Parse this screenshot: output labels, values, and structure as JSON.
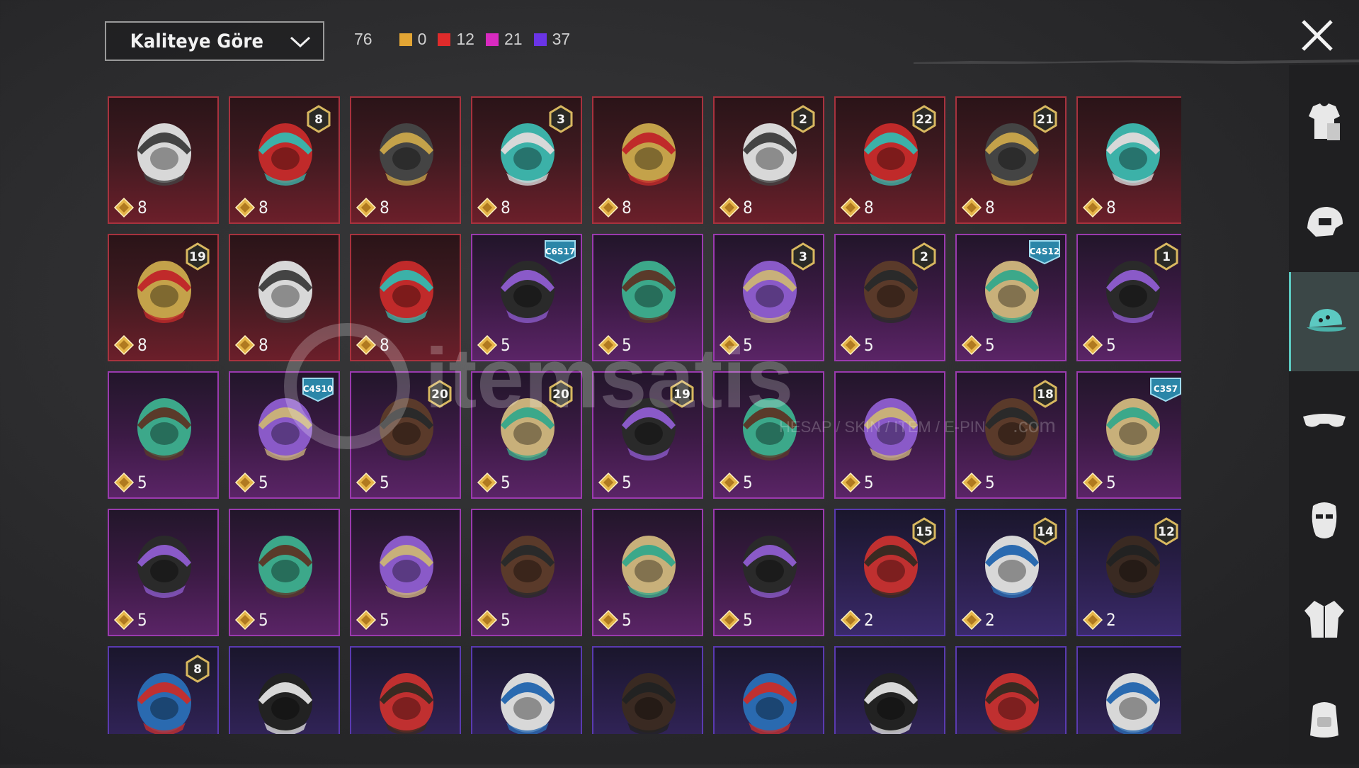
{
  "sort_dropdown": {
    "label": "Kaliteye Göre"
  },
  "counts": {
    "total": "76",
    "chips": [
      {
        "color": "#e2a534",
        "value": "0"
      },
      {
        "color": "#e02b2b",
        "value": "12"
      },
      {
        "color": "#d82ac0",
        "value": "21"
      },
      {
        "color": "#6a34e6",
        "value": "37"
      }
    ]
  },
  "watermark": {
    "brand": "itemsatis",
    "tagline": "HESAP / SKIN / ITEM / E-PIN",
    "domain": ".com"
  },
  "items": [
    {
      "rarity": "red",
      "price": "8",
      "badge": "",
      "art": "cowboy-hat-icon"
    },
    {
      "rarity": "red",
      "price": "8",
      "badge": "8",
      "art": "winged-hair-icon"
    },
    {
      "rarity": "red",
      "price": "8",
      "badge": "",
      "art": "red-helmet-icon"
    },
    {
      "rarity": "red",
      "price": "8",
      "badge": "3",
      "art": "joker-mask-icon"
    },
    {
      "rarity": "red",
      "price": "8",
      "badge": "",
      "art": "fin-helmet-icon"
    },
    {
      "rarity": "red",
      "price": "8",
      "badge": "2",
      "art": "bucket-hat-icon"
    },
    {
      "rarity": "red",
      "price": "8",
      "badge": "22",
      "art": "golden-mask-icon"
    },
    {
      "rarity": "red",
      "price": "8",
      "badge": "21",
      "art": "demon-mask-icon"
    },
    {
      "rarity": "red",
      "price": "8",
      "badge": "",
      "art": "horned-mask-icon"
    },
    {
      "rarity": "red",
      "price": "8",
      "badge": "19",
      "art": "robot-helmet-icon"
    },
    {
      "rarity": "red",
      "price": "8",
      "badge": "",
      "art": "red-armor-helmet-icon"
    },
    {
      "rarity": "red",
      "price": "8",
      "badge": "",
      "art": "knight-helmet-icon"
    },
    {
      "rarity": "mag",
      "price": "5",
      "badge": "C6S17",
      "art": "visor-hair-icon"
    },
    {
      "rarity": "mag",
      "price": "5",
      "badge": "",
      "art": "braided-hair-icon"
    },
    {
      "rarity": "mag",
      "price": "5",
      "badge": "3",
      "art": "jester-hat-icon"
    },
    {
      "rarity": "mag",
      "price": "5",
      "badge": "2",
      "art": "nurse-cap-icon"
    },
    {
      "rarity": "mag",
      "price": "5",
      "badge": "C4S12",
      "art": "headband-hair-icon"
    },
    {
      "rarity": "mag",
      "price": "5",
      "badge": "1",
      "art": "twin-tails-icon"
    },
    {
      "rarity": "mag",
      "price": "5",
      "badge": "",
      "art": "long-hair-icon"
    },
    {
      "rarity": "mag",
      "price": "5",
      "badge": "C4S10",
      "art": "green-helmet-icon"
    },
    {
      "rarity": "mag",
      "price": "5",
      "badge": "20",
      "art": "bunny-blonde-icon"
    },
    {
      "rarity": "mag",
      "price": "5",
      "badge": "20",
      "art": "gold-skull-icon"
    },
    {
      "rarity": "mag",
      "price": "5",
      "badge": "19",
      "art": "bow-hair-icon"
    },
    {
      "rarity": "mag",
      "price": "5",
      "badge": "",
      "art": "red-pigtails-icon"
    },
    {
      "rarity": "mag",
      "price": "5",
      "badge": "",
      "art": "blue-beast-icon"
    },
    {
      "rarity": "mag",
      "price": "5",
      "badge": "18",
      "art": "dark-hair-icon"
    },
    {
      "rarity": "mag",
      "price": "5",
      "badge": "C3S7",
      "art": "maid-headband-icon"
    },
    {
      "rarity": "mag",
      "price": "5",
      "badge": "",
      "art": "straw-hat-icon"
    },
    {
      "rarity": "mag",
      "price": "5",
      "badge": "",
      "art": "hooded-helmet-icon"
    },
    {
      "rarity": "mag",
      "price": "5",
      "badge": "",
      "art": "gas-mask-helmet-icon"
    },
    {
      "rarity": "mag",
      "price": "5",
      "badge": "",
      "art": "kendo-helmet-icon"
    },
    {
      "rarity": "mag",
      "price": "5",
      "badge": "",
      "art": "camel-hat-icon"
    },
    {
      "rarity": "mag",
      "price": "5",
      "badge": "",
      "art": "spiked-mask-icon"
    },
    {
      "rarity": "pur",
      "price": "2",
      "badge": "15",
      "art": "pumpkin-beanie-icon"
    },
    {
      "rarity": "pur",
      "price": "2",
      "badge": "14",
      "art": "cat-cap-hair-icon"
    },
    {
      "rarity": "pur",
      "price": "2",
      "badge": "12",
      "art": "bunny-helmet-icon"
    },
    {
      "rarity": "pur",
      "price": "",
      "badge": "8",
      "art": "green-skull-hair-icon"
    },
    {
      "rarity": "pur",
      "price": "",
      "badge": "",
      "art": "blue-cap-icon"
    },
    {
      "rarity": "pur",
      "price": "",
      "badge": "",
      "art": "goggle-helmet-icon"
    },
    {
      "rarity": "pur",
      "price": "",
      "badge": "",
      "art": "tactical-helmet-icon"
    },
    {
      "rarity": "pur",
      "price": "",
      "badge": "",
      "art": "red-white-cap-icon"
    },
    {
      "rarity": "pur",
      "price": "",
      "badge": "",
      "art": "beanie-icon"
    },
    {
      "rarity": "pur",
      "price": "",
      "badge": "",
      "art": "football-helmet-icon"
    },
    {
      "rarity": "pur",
      "price": "",
      "badge": "",
      "art": "cricket-helmet-icon"
    },
    {
      "rarity": "pur",
      "price": "",
      "badge": "",
      "art": "cyber-helmet-hair-icon"
    }
  ],
  "sidebar": {
    "tabs": [
      {
        "icon": "outfit-icon",
        "active": false
      },
      {
        "icon": "helmet-icon",
        "active": false
      },
      {
        "icon": "cap-icon",
        "active": true
      },
      {
        "icon": "glasses-icon",
        "active": false
      },
      {
        "icon": "mask-icon",
        "active": false
      },
      {
        "icon": "jacket-icon",
        "active": false
      },
      {
        "icon": "backpack-icon",
        "active": false
      }
    ]
  },
  "colors": {
    "gem": "#e6b64a",
    "badge_gold": "#d8b860",
    "badge_season": "#2b86a8",
    "active_tab": "#5cc9c1"
  }
}
